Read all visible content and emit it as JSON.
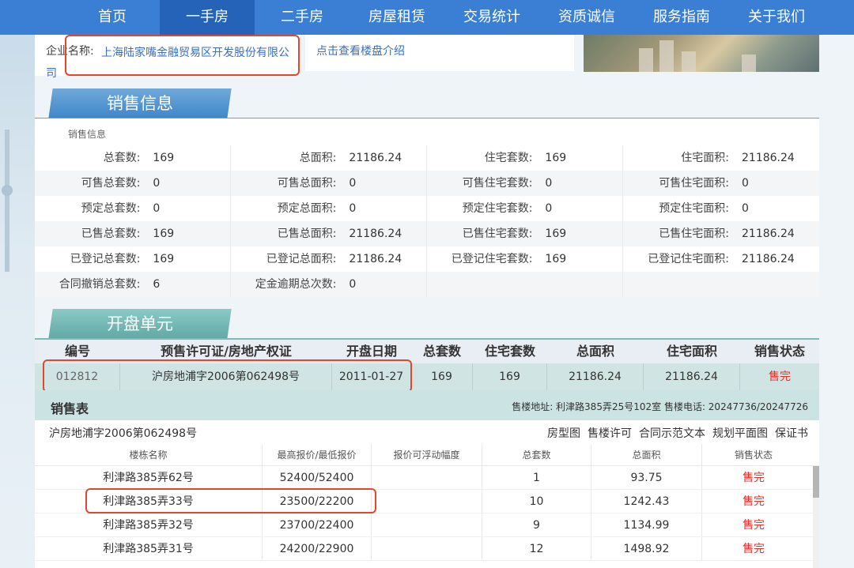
{
  "nav": {
    "items": [
      "首页",
      "一手房",
      "二手房",
      "房屋租赁",
      "交易统计",
      "资质诚信",
      "服务指南",
      "关于我们"
    ],
    "active_index": 1
  },
  "enterprise": {
    "label": "企业名称:",
    "name": "上海陆家嘴金融贸易区开发股份有限公司",
    "intro_link": "点击查看楼盘介绍"
  },
  "sales_info": {
    "tab": "销售信息",
    "caption": "销售信息",
    "rows": [
      [
        {
          "k": "总套数:",
          "v": "169"
        },
        {
          "k": "总面积:",
          "v": "21186.24"
        },
        {
          "k": "住宅套数:",
          "v": "169"
        },
        {
          "k": "住宅面积:",
          "v": "21186.24"
        }
      ],
      [
        {
          "k": "可售总套数:",
          "v": "0"
        },
        {
          "k": "可售总面积:",
          "v": "0"
        },
        {
          "k": "可售住宅套数:",
          "v": "0"
        },
        {
          "k": "可售住宅面积:",
          "v": "0"
        }
      ],
      [
        {
          "k": "预定总套数:",
          "v": "0"
        },
        {
          "k": "预定总面积:",
          "v": "0"
        },
        {
          "k": "预定住宅套数:",
          "v": "0"
        },
        {
          "k": "预定住宅面积:",
          "v": "0"
        }
      ],
      [
        {
          "k": "已售总套数:",
          "v": "169"
        },
        {
          "k": "已售总面积:",
          "v": "21186.24"
        },
        {
          "k": "已售住宅套数:",
          "v": "169"
        },
        {
          "k": "已售住宅面积:",
          "v": "21186.24"
        }
      ],
      [
        {
          "k": "已登记总套数:",
          "v": "169"
        },
        {
          "k": "已登记总面积:",
          "v": "21186.24"
        },
        {
          "k": "已登记住宅套数:",
          "v": "169"
        },
        {
          "k": "已登记住宅面积:",
          "v": "21186.24"
        }
      ],
      [
        {
          "k": "合同撤销总套数:",
          "v": "6"
        },
        {
          "k": "定金逾期总次数:",
          "v": "0"
        },
        {
          "k": "",
          "v": ""
        },
        {
          "k": "",
          "v": ""
        }
      ]
    ]
  },
  "units": {
    "tab": "开盘单元",
    "headers": [
      "编号",
      "预售许可证/房地产权证",
      "开盘日期",
      "总套数",
      "住宅套数",
      "总面积",
      "住宅面积",
      "销售状态"
    ],
    "row": [
      "012812",
      "沪房地浦字2006第062498号",
      "2011-01-27",
      "169",
      "169",
      "21186.24",
      "21186.24",
      "售完"
    ]
  },
  "sales_table": {
    "title": "销售表",
    "address": "售楼地址: 利津路385弄25号102室 售楼电话: 20247736/20247726",
    "permit": "沪房地浦字2006第062498号",
    "links": [
      "房型图",
      "售楼许可",
      "合同示范文本",
      "规划平面图",
      "保证书"
    ],
    "headers": [
      "楼栋名称",
      "最高报价/最低报价",
      "报价可浮动幅度",
      "总套数",
      "总面积",
      "销售状态"
    ],
    "rows": [
      [
        "利津路385弄62号",
        "52400/52400",
        "",
        "1",
        "93.75",
        "售完"
      ],
      [
        "利津路385弄33号",
        "23500/22200",
        "",
        "10",
        "1242.43",
        "售完"
      ],
      [
        "利津路385弄32号",
        "23700/22400",
        "",
        "9",
        "1134.99",
        "售完"
      ],
      [
        "利津路385弄31号",
        "24200/22900",
        "",
        "12",
        "1498.92",
        "售完"
      ]
    ]
  },
  "colors": {
    "nav_bg": "#3b7fd4",
    "nav_active": "#2563b8",
    "highlight_box": "#e0472f",
    "status_red": "#e0302a"
  }
}
